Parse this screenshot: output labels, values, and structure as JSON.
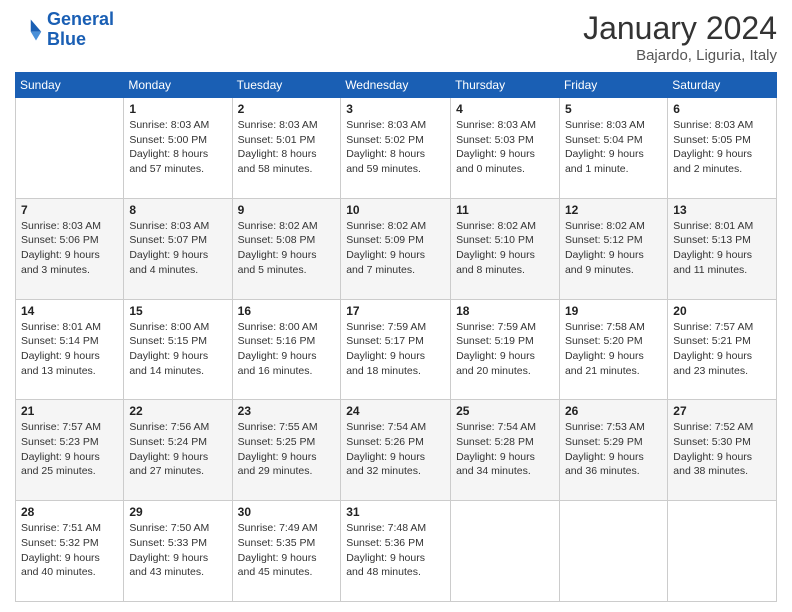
{
  "logo": {
    "text_general": "General",
    "text_blue": "Blue"
  },
  "title": "January 2024",
  "location": "Bajardo, Liguria, Italy",
  "headers": [
    "Sunday",
    "Monday",
    "Tuesday",
    "Wednesday",
    "Thursday",
    "Friday",
    "Saturday"
  ],
  "weeks": [
    [
      {
        "day": "",
        "info": ""
      },
      {
        "day": "1",
        "info": "Sunrise: 8:03 AM\nSunset: 5:00 PM\nDaylight: 8 hours\nand 57 minutes."
      },
      {
        "day": "2",
        "info": "Sunrise: 8:03 AM\nSunset: 5:01 PM\nDaylight: 8 hours\nand 58 minutes."
      },
      {
        "day": "3",
        "info": "Sunrise: 8:03 AM\nSunset: 5:02 PM\nDaylight: 8 hours\nand 59 minutes."
      },
      {
        "day": "4",
        "info": "Sunrise: 8:03 AM\nSunset: 5:03 PM\nDaylight: 9 hours\nand 0 minutes."
      },
      {
        "day": "5",
        "info": "Sunrise: 8:03 AM\nSunset: 5:04 PM\nDaylight: 9 hours\nand 1 minute."
      },
      {
        "day": "6",
        "info": "Sunrise: 8:03 AM\nSunset: 5:05 PM\nDaylight: 9 hours\nand 2 minutes."
      }
    ],
    [
      {
        "day": "7",
        "info": "Sunrise: 8:03 AM\nSunset: 5:06 PM\nDaylight: 9 hours\nand 3 minutes."
      },
      {
        "day": "8",
        "info": "Sunrise: 8:03 AM\nSunset: 5:07 PM\nDaylight: 9 hours\nand 4 minutes."
      },
      {
        "day": "9",
        "info": "Sunrise: 8:02 AM\nSunset: 5:08 PM\nDaylight: 9 hours\nand 5 minutes."
      },
      {
        "day": "10",
        "info": "Sunrise: 8:02 AM\nSunset: 5:09 PM\nDaylight: 9 hours\nand 7 minutes."
      },
      {
        "day": "11",
        "info": "Sunrise: 8:02 AM\nSunset: 5:10 PM\nDaylight: 9 hours\nand 8 minutes."
      },
      {
        "day": "12",
        "info": "Sunrise: 8:02 AM\nSunset: 5:12 PM\nDaylight: 9 hours\nand 9 minutes."
      },
      {
        "day": "13",
        "info": "Sunrise: 8:01 AM\nSunset: 5:13 PM\nDaylight: 9 hours\nand 11 minutes."
      }
    ],
    [
      {
        "day": "14",
        "info": "Sunrise: 8:01 AM\nSunset: 5:14 PM\nDaylight: 9 hours\nand 13 minutes."
      },
      {
        "day": "15",
        "info": "Sunrise: 8:00 AM\nSunset: 5:15 PM\nDaylight: 9 hours\nand 14 minutes."
      },
      {
        "day": "16",
        "info": "Sunrise: 8:00 AM\nSunset: 5:16 PM\nDaylight: 9 hours\nand 16 minutes."
      },
      {
        "day": "17",
        "info": "Sunrise: 7:59 AM\nSunset: 5:17 PM\nDaylight: 9 hours\nand 18 minutes."
      },
      {
        "day": "18",
        "info": "Sunrise: 7:59 AM\nSunset: 5:19 PM\nDaylight: 9 hours\nand 20 minutes."
      },
      {
        "day": "19",
        "info": "Sunrise: 7:58 AM\nSunset: 5:20 PM\nDaylight: 9 hours\nand 21 minutes."
      },
      {
        "day": "20",
        "info": "Sunrise: 7:57 AM\nSunset: 5:21 PM\nDaylight: 9 hours\nand 23 minutes."
      }
    ],
    [
      {
        "day": "21",
        "info": "Sunrise: 7:57 AM\nSunset: 5:23 PM\nDaylight: 9 hours\nand 25 minutes."
      },
      {
        "day": "22",
        "info": "Sunrise: 7:56 AM\nSunset: 5:24 PM\nDaylight: 9 hours\nand 27 minutes."
      },
      {
        "day": "23",
        "info": "Sunrise: 7:55 AM\nSunset: 5:25 PM\nDaylight: 9 hours\nand 29 minutes."
      },
      {
        "day": "24",
        "info": "Sunrise: 7:54 AM\nSunset: 5:26 PM\nDaylight: 9 hours\nand 32 minutes."
      },
      {
        "day": "25",
        "info": "Sunrise: 7:54 AM\nSunset: 5:28 PM\nDaylight: 9 hours\nand 34 minutes."
      },
      {
        "day": "26",
        "info": "Sunrise: 7:53 AM\nSunset: 5:29 PM\nDaylight: 9 hours\nand 36 minutes."
      },
      {
        "day": "27",
        "info": "Sunrise: 7:52 AM\nSunset: 5:30 PM\nDaylight: 9 hours\nand 38 minutes."
      }
    ],
    [
      {
        "day": "28",
        "info": "Sunrise: 7:51 AM\nSunset: 5:32 PM\nDaylight: 9 hours\nand 40 minutes."
      },
      {
        "day": "29",
        "info": "Sunrise: 7:50 AM\nSunset: 5:33 PM\nDaylight: 9 hours\nand 43 minutes."
      },
      {
        "day": "30",
        "info": "Sunrise: 7:49 AM\nSunset: 5:35 PM\nDaylight: 9 hours\nand 45 minutes."
      },
      {
        "day": "31",
        "info": "Sunrise: 7:48 AM\nSunset: 5:36 PM\nDaylight: 9 hours\nand 48 minutes."
      },
      {
        "day": "",
        "info": ""
      },
      {
        "day": "",
        "info": ""
      },
      {
        "day": "",
        "info": ""
      }
    ]
  ]
}
